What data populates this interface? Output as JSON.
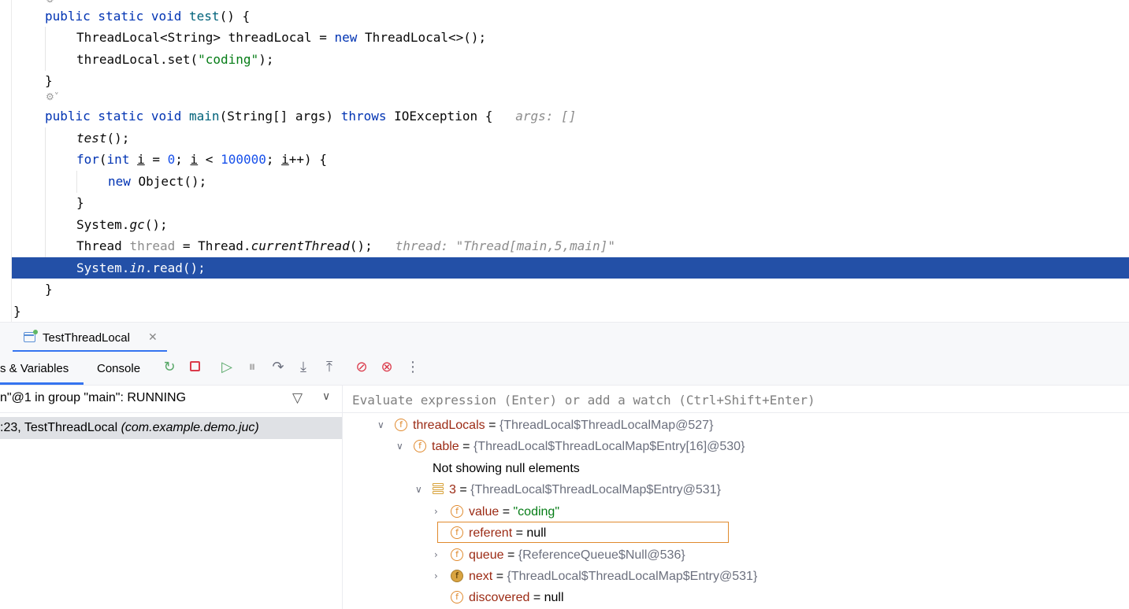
{
  "editor": {
    "lines": [
      {
        "tokens": [
          [
            "kw",
            "public static void "
          ],
          [
            "fn",
            "test"
          ],
          [
            "",
            "() {"
          ]
        ]
      },
      {
        "tokens": [
          [
            "",
            "ThreadLocal<String> threadLocal = "
          ],
          [
            "kw",
            "new "
          ],
          [
            "",
            "ThreadLocal<>();"
          ]
        ]
      },
      {
        "tokens": [
          [
            "",
            "threadLocal.set("
          ],
          [
            "str",
            "\"coding\""
          ],
          [
            "",
            ");"
          ]
        ]
      },
      {
        "tokens": [
          [
            "",
            "}"
          ]
        ]
      },
      {
        "tokens": [
          [
            "kw",
            "public static void "
          ],
          [
            "fn",
            "main"
          ],
          [
            "",
            "(String[] args) "
          ],
          [
            "kw",
            "throws "
          ],
          [
            "",
            "IOException {"
          ],
          [
            "hint",
            "   args: []"
          ]
        ]
      },
      {
        "tokens": [
          [
            "it",
            "test"
          ],
          [
            "",
            "();"
          ]
        ]
      },
      {
        "tokens": [
          [
            "kw",
            "for"
          ],
          [
            "",
            "("
          ],
          [
            "kw",
            "int "
          ],
          [
            "ul",
            "i"
          ],
          [
            "",
            " = "
          ],
          [
            "num",
            "0"
          ],
          [
            "",
            "; "
          ],
          [
            "ul",
            "i"
          ],
          [
            "",
            " < "
          ],
          [
            "num",
            "100000"
          ],
          [
            "",
            "; "
          ],
          [
            "ul",
            "i"
          ],
          [
            "",
            "++) {"
          ]
        ]
      },
      {
        "tokens": [
          [
            "kw",
            "new "
          ],
          [
            "",
            "Object();"
          ]
        ]
      },
      {
        "tokens": [
          [
            "",
            "}"
          ]
        ]
      },
      {
        "tokens": [
          [
            "",
            "System."
          ],
          [
            "it",
            "gc"
          ],
          [
            "",
            "();"
          ]
        ]
      },
      {
        "tokens": [
          [
            "",
            "Thread "
          ],
          [
            "gray",
            "thread"
          ],
          [
            "",
            " = Thread."
          ],
          [
            "it",
            "currentThread"
          ],
          [
            "",
            "();"
          ],
          [
            "hint",
            "   thread: \"Thread[main,5,main]\""
          ]
        ]
      },
      {
        "tokens": [
          [
            "",
            "System."
          ],
          [
            "it",
            "in"
          ],
          [
            "",
            ".read();"
          ]
        ]
      },
      {
        "tokens": [
          [
            "",
            "}"
          ]
        ]
      },
      {
        "tokens": [
          [
            "",
            "}"
          ]
        ]
      }
    ]
  },
  "run_tab": {
    "label": "TestThreadLocal"
  },
  "toolbar": {
    "frames_tab": "s & Variables",
    "console_tab": "Console"
  },
  "thread": {
    "label": "n\"@1 in group \"main\": RUNNING"
  },
  "frame": {
    "location": ":23, TestThreadLocal ",
    "package": "(com.example.demo.juc)"
  },
  "evaluate": {
    "placeholder": "Evaluate expression (Enter) or add a watch (Ctrl+Shift+Enter)"
  },
  "variables": {
    "threadLocals": {
      "name": "threadLocals",
      "value": "{ThreadLocal$ThreadLocalMap@527}"
    },
    "table": {
      "name": "table",
      "value": "{ThreadLocal$ThreadLocalMap$Entry[16]@530}"
    },
    "info": "Not showing null elements",
    "entry3": {
      "name": "3",
      "value": "{ThreadLocal$ThreadLocalMap$Entry@531}"
    },
    "value": {
      "name": "value",
      "value": "\"coding\""
    },
    "referent": {
      "name": "referent",
      "value": "null"
    },
    "queue": {
      "name": "queue",
      "value": "{ReferenceQueue$Null@536}"
    },
    "next": {
      "name": "next",
      "value": "{ThreadLocal$ThreadLocalMap$Entry@531}"
    },
    "discovered": {
      "name": "discovered",
      "value": "null"
    },
    "equals": "="
  },
  "icons": {
    "field": "f"
  }
}
